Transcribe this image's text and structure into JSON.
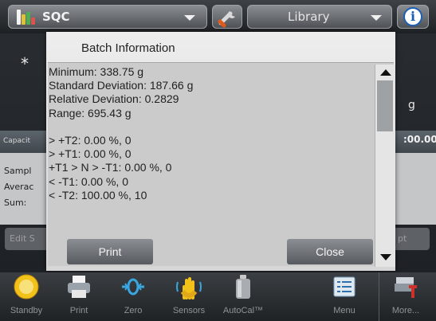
{
  "topbar": {
    "app_name": "SQC",
    "library_label": "Library",
    "info_glyph": "i",
    "app_icon": "bar-chart-icon",
    "tools_icon": "wrench-icon"
  },
  "background": {
    "star": "*",
    "unit": "g",
    "capacity_label": "Capacit",
    "capacity_value": ":00.00",
    "rows": [
      "Sampl",
      "Averac",
      "Sum:"
    ],
    "edit_button": "Edit S",
    "accept_button": "pt"
  },
  "dialog": {
    "title": "Batch Information",
    "lines": [
      "Minimum: 338.75 g",
      "Standard Deviation: 187.66 g",
      "Relative Deviation: 0.2829",
      "Range: 695.43 g",
      "",
      "> +T2: 0.00 %, 0",
      "> +T1: 0.00 %, 0",
      "+T1 > N > -T1: 0.00 %, 0",
      "< -T1: 0.00 %, 0",
      "< -T2: 100.00 %, 10"
    ],
    "print_label": "Print",
    "close_label": "Close"
  },
  "toolbar": {
    "items": [
      {
        "label": "Standby",
        "icon": "standby-icon"
      },
      {
        "label": "Print",
        "icon": "printer-icon"
      },
      {
        "label": "Zero",
        "icon": "zero-icon"
      },
      {
        "label": "Sensors",
        "icon": "hand-sensor-icon"
      },
      {
        "label": "AutoCal™",
        "icon": "calibration-weight-icon"
      },
      {
        "label": "Menu",
        "icon": "menu-list-icon"
      },
      {
        "label": "More...",
        "icon": "more-icon"
      }
    ]
  },
  "colors": {
    "accent_blue": "#1a5fb4",
    "standby_yellow": "#f2c21b"
  }
}
